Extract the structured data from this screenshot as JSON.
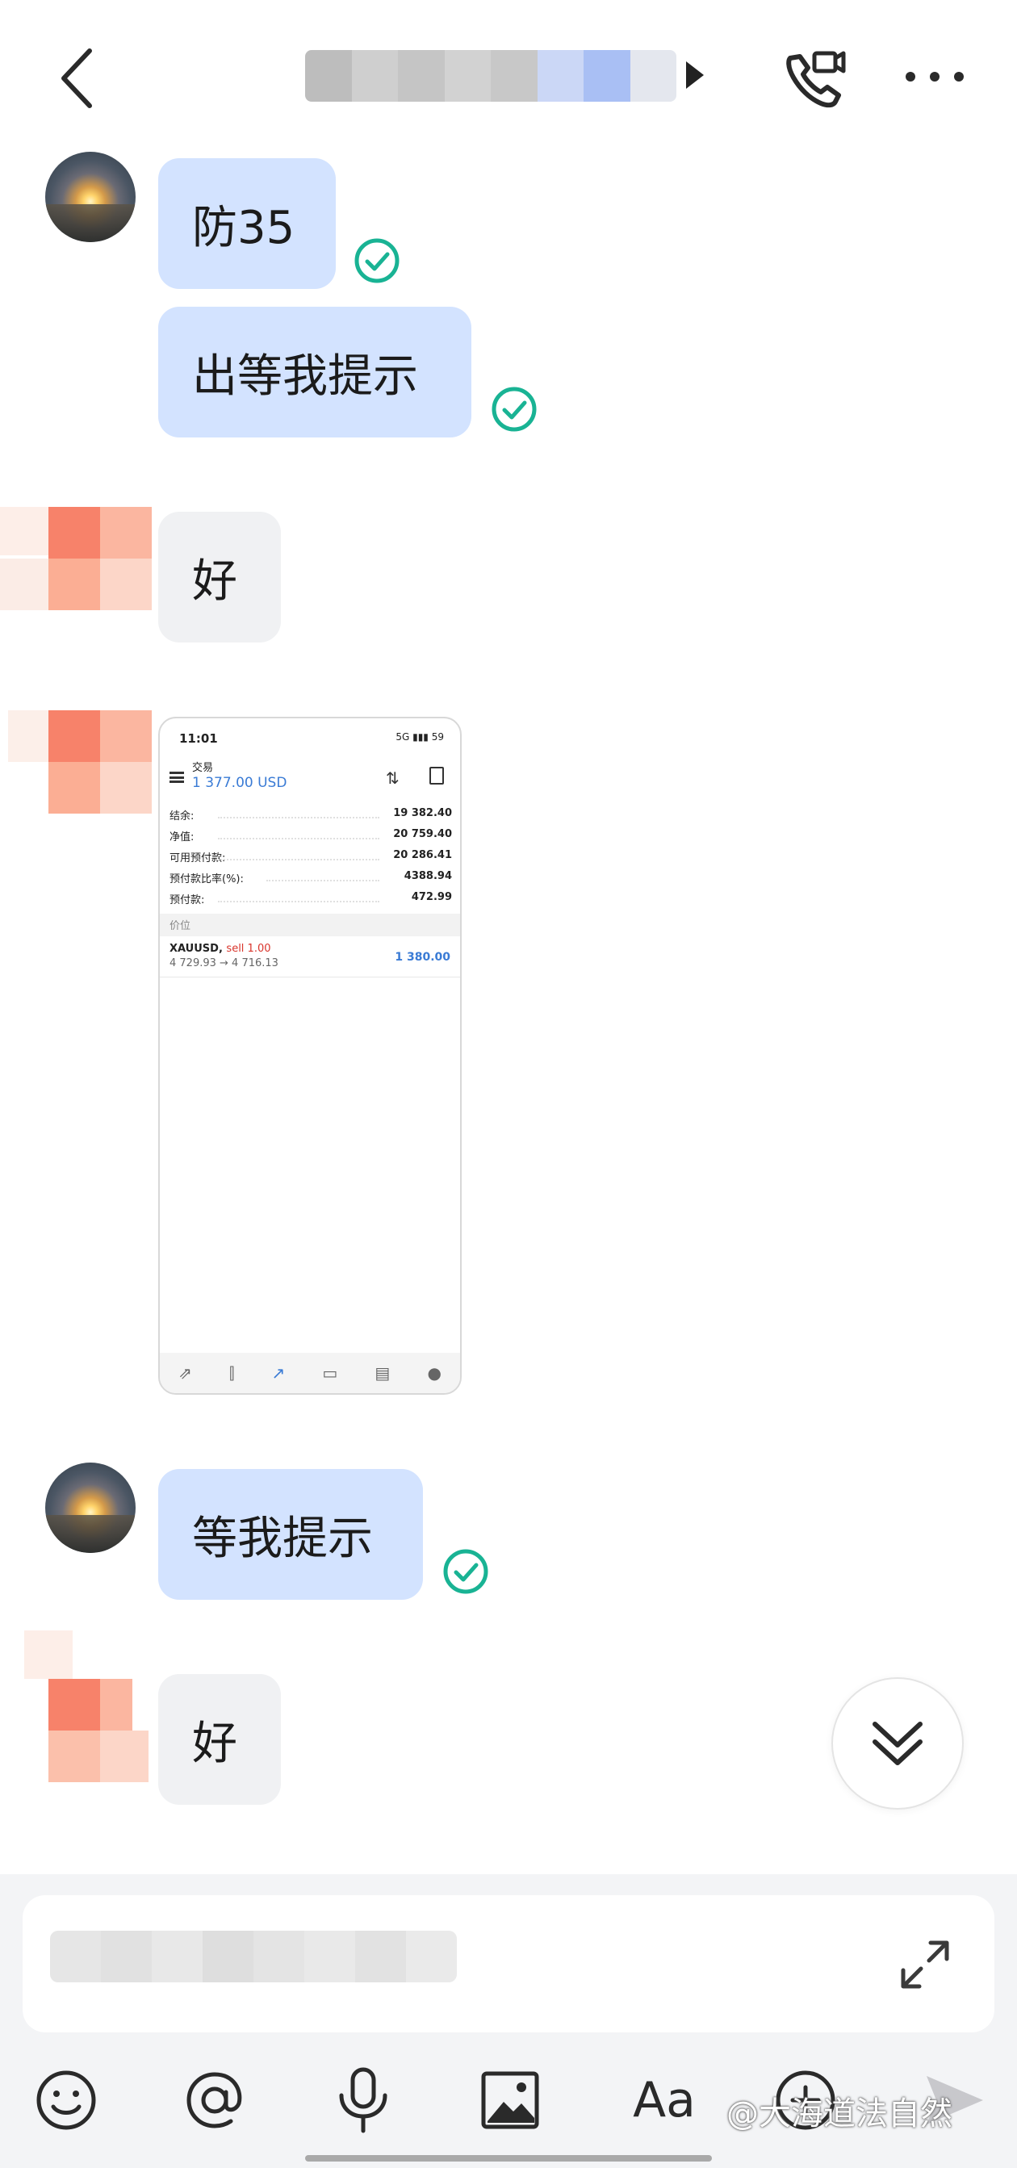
{
  "header": {
    "back_icon": "chevron-left-icon",
    "call_icon": "phone-video-icon",
    "more_icon": "more-dots-icon"
  },
  "messages": [
    {
      "sender": "me",
      "text": "防35",
      "read": true
    },
    {
      "sender": "me",
      "text": "出等我提示",
      "read": true
    },
    {
      "sender": "other",
      "text": "好"
    },
    {
      "sender": "other",
      "type": "image"
    },
    {
      "sender": "me",
      "text": "等我提示",
      "read": true
    },
    {
      "sender": "other",
      "text": "好"
    }
  ],
  "shared_image": {
    "status_time": "11:01",
    "status_right": "5G ▮▮▮ 59",
    "title": "交易",
    "balance_header": "1 377.00 USD",
    "rows": [
      {
        "label": "结余:",
        "value": "19 382.40"
      },
      {
        "label": "净值:",
        "value": "20 759.40"
      },
      {
        "label": "可用预付款:",
        "value": "20 286.41"
      },
      {
        "label": "预付款比率(%):",
        "value": "4388.94"
      },
      {
        "label": "预付款:",
        "value": "472.99"
      }
    ],
    "section_label": "价位",
    "position_symbol": "XAUUSD,",
    "position_side": "sell 1.00",
    "position_prices": "4 729.93 → 4 716.13",
    "position_profit": "1 380.00"
  },
  "composer": {
    "expand_icon": "expand-icon"
  },
  "toolbar": {
    "aa_label": "Aa",
    "icons": [
      "emoji-icon",
      "mention-icon",
      "microphone-icon",
      "image-icon",
      "text-format-icon",
      "plus-circle-icon",
      "send-icon"
    ]
  },
  "watermark": "@大海道法自然",
  "colors": {
    "my_bubble": "#d3e3ff",
    "other_bubble": "#f0f1f3",
    "read_check": "#19b394",
    "accent": "#3a7bd5"
  }
}
